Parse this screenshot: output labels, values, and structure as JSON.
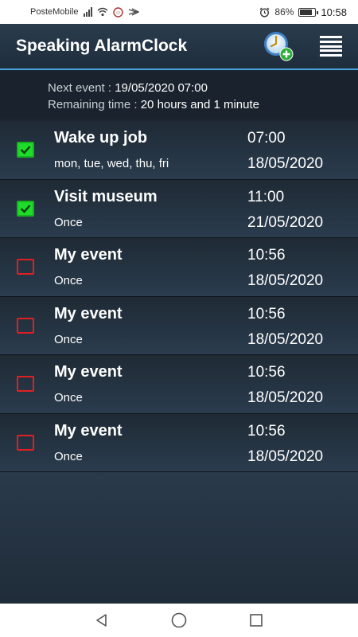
{
  "status": {
    "carrier": "PosteMobile",
    "battery": "86%",
    "battery_level": 0.86,
    "time": "10:58",
    "icons": [
      "signal-icon",
      "wifi-icon",
      "notification-icon",
      "alarm-icon",
      "battery-icon"
    ]
  },
  "app": {
    "title": "Speaking AlarmClock",
    "accent": "#4aa3d8"
  },
  "info": {
    "next_label": "Next event : ",
    "next_value": "19/05/2020 07:00",
    "remaining_label": "Remaining time : ",
    "remaining_value": "20 hours and 1 minute"
  },
  "events": [
    {
      "title": "Wake up job",
      "repeat": "mon, tue, wed, thu, fri",
      "time": "07:00",
      "date": "18/05/2020",
      "enabled": true
    },
    {
      "title": "Visit museum",
      "repeat": "Once",
      "time": "11:00",
      "date": "21/05/2020",
      "enabled": true
    },
    {
      "title": "My event",
      "repeat": "Once",
      "time": "10:56",
      "date": "18/05/2020",
      "enabled": false
    },
    {
      "title": "My event",
      "repeat": "Once",
      "time": "10:56",
      "date": "18/05/2020",
      "enabled": false
    },
    {
      "title": "My event",
      "repeat": "Once",
      "time": "10:56",
      "date": "18/05/2020",
      "enabled": false
    },
    {
      "title": "My event",
      "repeat": "Once",
      "time": "10:56",
      "date": "18/05/2020",
      "enabled": false
    }
  ],
  "colors": {
    "enabled": "#1fdc2a",
    "disabled": "#e02020"
  }
}
